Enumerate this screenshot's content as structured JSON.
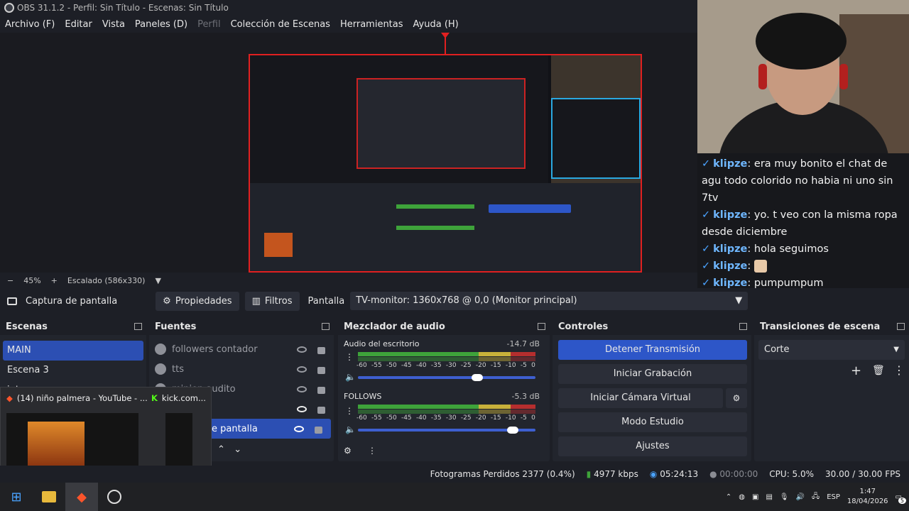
{
  "window": {
    "title": "OBS 31.1.2 - Perfil: Sin Título - Escenas: Sin Título"
  },
  "menu": [
    "Archivo (F)",
    "Editar",
    "Vista",
    "Paneles (D)",
    "Perfil",
    "Colección de Escenas",
    "Herramientas",
    "Ayuda (H)"
  ],
  "preview": {
    "zoom": "45%",
    "scaling": "Escalado (586x330)"
  },
  "chat": [
    {
      "user": "klipze",
      "text": "era muy bonito el chat de agu todo colorido no habia ni uno sin 7tv"
    },
    {
      "user": "klipze",
      "text": "yo. t veo con la misma ropa desde diciembre"
    },
    {
      "user": "klipze",
      "text": "hola seguimos"
    },
    {
      "user": "klipze",
      "text": ""
    },
    {
      "user": "klipze",
      "text": "pumpumpum"
    }
  ],
  "source_bar": {
    "selected": "Captura de pantalla",
    "properties": "Propiedades",
    "filters": "Filtros",
    "display_label": "Pantalla",
    "display_value": "TV-monitor: 1360x768 @ 0,0 (Monitor principal)"
  },
  "scenes": {
    "title": "Escenas",
    "items": [
      "MAIN",
      "Escena 3",
      "intro"
    ]
  },
  "sources": {
    "title": "Fuentes",
    "items": [
      "followers contador",
      "tts",
      "minion audito",
      "",
      "Captura de pantalla"
    ],
    "selected_partial": "e pantalla"
  },
  "mixer": {
    "title": "Mezclador de audio",
    "channels": [
      {
        "name": "Audio del escritorio",
        "db": "-14.7 dB"
      },
      {
        "name": "FOLLOWS",
        "db": "-5.3 dB"
      }
    ],
    "ticks": [
      "-60",
      "-55",
      "-50",
      "-45",
      "-40",
      "-35",
      "-30",
      "-25",
      "-20",
      "-15",
      "-10",
      "-5",
      "0"
    ]
  },
  "controls": {
    "title": "Controles",
    "stop_stream": "Detener Transmisión",
    "start_recording": "Iniciar Grabación",
    "virtual_cam": "Iniciar Cámara Virtual",
    "studio_mode": "Modo Estudio",
    "settings": "Ajustes"
  },
  "transitions": {
    "title": "Transiciones de escena",
    "value": "Corte"
  },
  "thumbnails": [
    {
      "title": "(14) niño palmera - YouTube - ..."
    },
    {
      "title": "kick.com..."
    }
  ],
  "status": {
    "dropped": "Fotogramas Perdidos 2377 (0.4%)",
    "bitrate": "4977 kbps",
    "stream_time": "05:24:13",
    "rec_time": "00:00:00",
    "cpu": "CPU: 5.0%",
    "fps": "30.00 / 30.00 FPS"
  },
  "taskbar": {
    "lang": "ESP",
    "time": "1:47",
    "date": "18/04/2026",
    "notif_count": "5"
  }
}
